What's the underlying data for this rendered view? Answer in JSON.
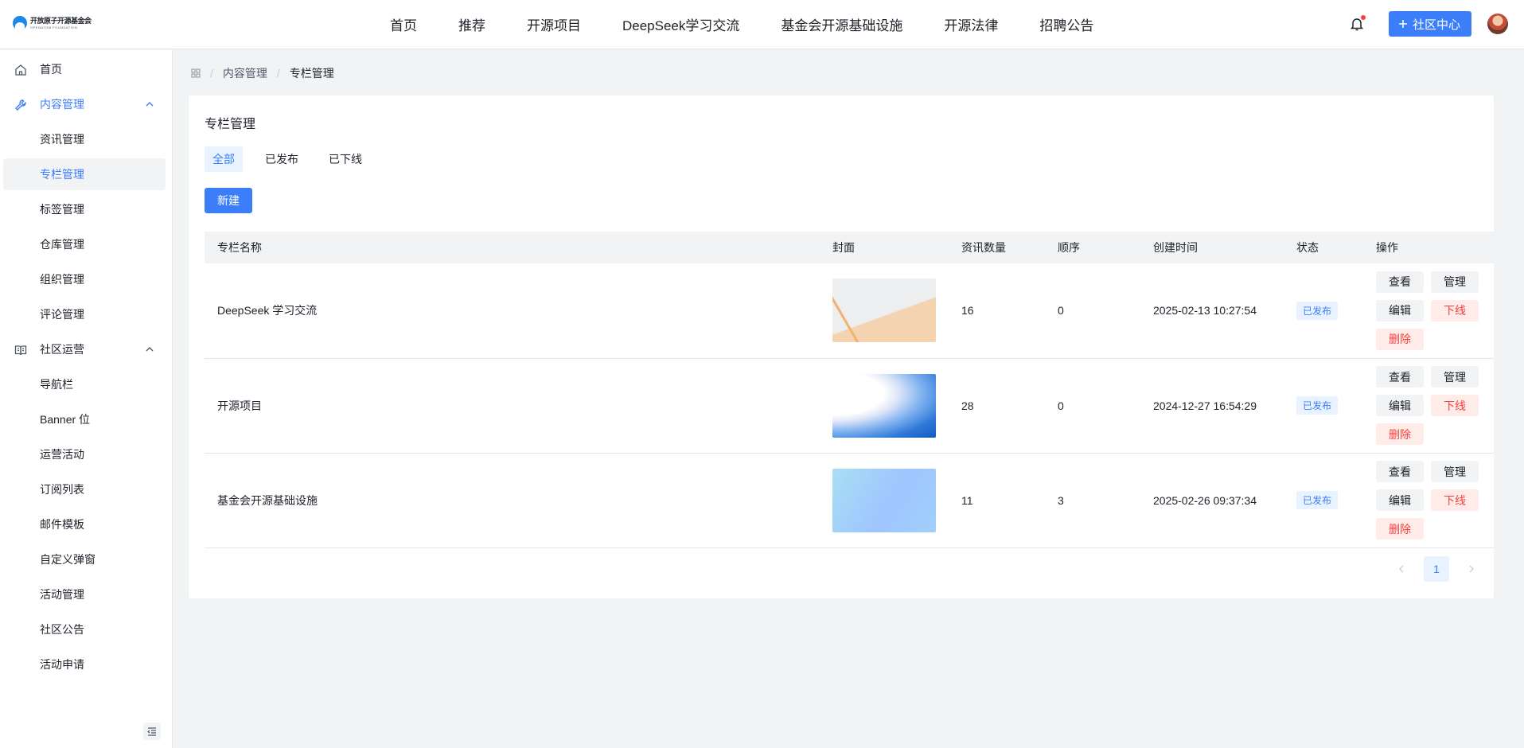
{
  "header": {
    "logo_cn": "开放原子开源基金会",
    "logo_en": "OPENATOM FOUNDATION",
    "nav": [
      "首页",
      "推荐",
      "开源项目",
      "DeepSeek学习交流",
      "基金会开源基础设施",
      "开源法律",
      "招聘公告"
    ],
    "community_button": "社区中心"
  },
  "sidebar": {
    "home": "首页",
    "content_group": "内容管理",
    "content_items": [
      "资讯管理",
      "专栏管理",
      "标签管理",
      "仓库管理",
      "组织管理",
      "评论管理"
    ],
    "community_group": "社区运营",
    "community_items": [
      "导航栏",
      "Banner 位",
      "运营活动",
      "订阅列表",
      "邮件模板",
      "自定义弹窗",
      "活动管理",
      "社区公告",
      "活动申请"
    ]
  },
  "breadcrumb": {
    "level1": "内容管理",
    "level2": "专栏管理"
  },
  "page": {
    "title": "专栏管理",
    "tabs": [
      "全部",
      "已发布",
      "已下线"
    ],
    "new_button": "新建"
  },
  "table": {
    "headers": [
      "专栏名称",
      "封面",
      "资讯数量",
      "顺序",
      "创建时间",
      "状态",
      "操作"
    ],
    "rows": [
      {
        "name": "DeepSeek 学习交流",
        "count": "16",
        "order": "0",
        "created": "2025-02-13 10:27:54",
        "status": "已发布"
      },
      {
        "name": "开源项目",
        "count": "28",
        "order": "0",
        "created": "2024-12-27 16:54:29",
        "status": "已发布"
      },
      {
        "name": "基金会开源基础设施",
        "count": "11",
        "order": "3",
        "created": "2025-02-26 09:37:34",
        "status": "已发布"
      }
    ],
    "ops": {
      "view": "查看",
      "manage": "管理",
      "edit": "编辑",
      "offline": "下线",
      "delete": "删除"
    }
  },
  "pagination": {
    "current": "1"
  }
}
